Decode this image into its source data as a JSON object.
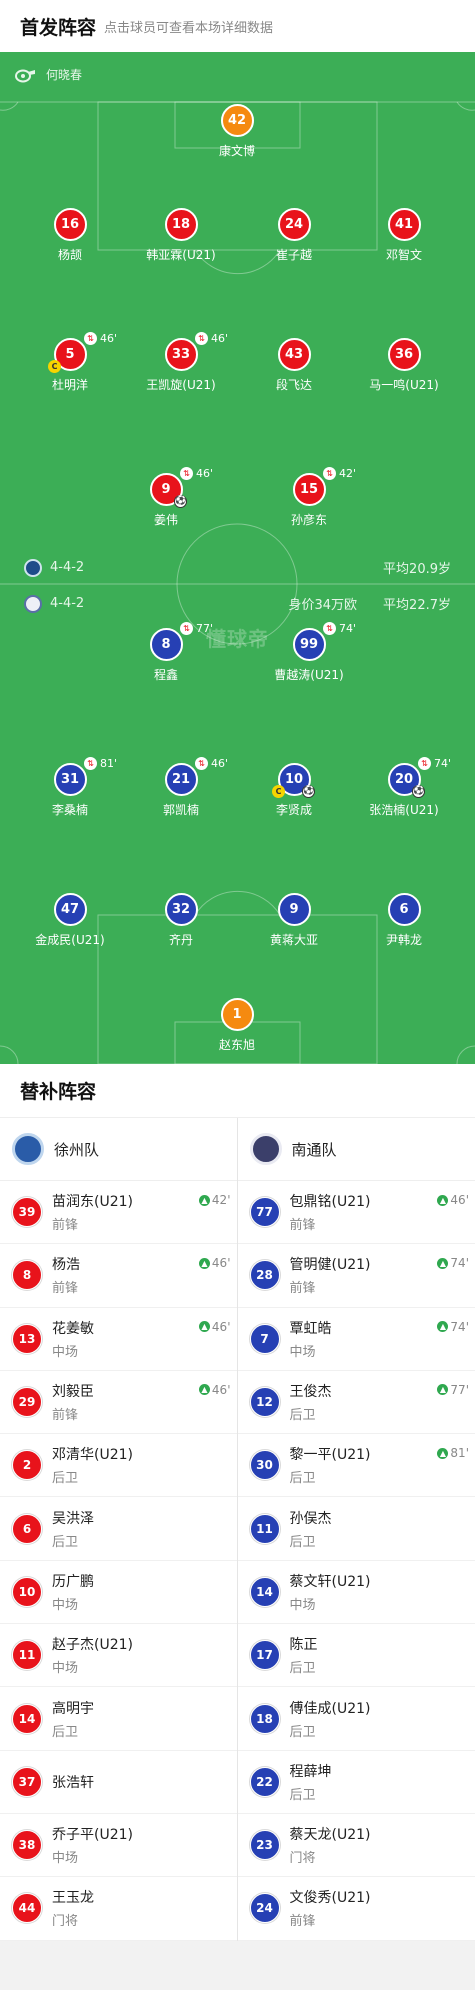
{
  "header": {
    "title": "首发阵容",
    "hint": "点击球员可查看本场详细数据"
  },
  "referee": {
    "name": "何晓春",
    "icon": "whistle-icon"
  },
  "watermark": "懂球帝",
  "home_team": {
    "name": "南通队",
    "formation": "4-4-2",
    "avg_age": "平均20.9岁",
    "color": "#e8131b"
  },
  "away_team": {
    "name": "徐州队",
    "formation": "4-4-2",
    "worth": "身价34万欧",
    "avg_age": "平均22.7岁",
    "color": "#2640b4"
  },
  "pitch_players": [
    {
      "num": "42",
      "name": "康文博",
      "color": "orange"
    },
    {
      "num": "16",
      "name": "杨颉",
      "color": "red"
    },
    {
      "num": "18",
      "name": "韩亚霖(U21)",
      "color": "red"
    },
    {
      "num": "24",
      "name": "崔子越",
      "color": "red"
    },
    {
      "num": "41",
      "name": "邓智文",
      "color": "red"
    },
    {
      "num": "5",
      "name": "杜明洋",
      "color": "red",
      "sub": "46'",
      "captain": true
    },
    {
      "num": "33",
      "name": "王凯旋(U21)",
      "color": "red",
      "sub": "46'"
    },
    {
      "num": "43",
      "name": "段飞达",
      "color": "red"
    },
    {
      "num": "36",
      "name": "马一鸣(U21)",
      "color": "red"
    },
    {
      "num": "9",
      "name": "姜伟",
      "color": "red",
      "sub": "46'",
      "goal": true
    },
    {
      "num": "15",
      "name": "孙彦东",
      "color": "red",
      "sub": "42'"
    },
    {
      "num": "8",
      "name": "程鑫",
      "color": "blue",
      "sub": "77'"
    },
    {
      "num": "99",
      "name": "曹越涛(U21)",
      "color": "blue",
      "sub": "74'"
    },
    {
      "num": "31",
      "name": "李桑楠",
      "color": "blue",
      "sub": "81'"
    },
    {
      "num": "21",
      "name": "郭凯楠",
      "color": "blue",
      "sub": "46'"
    },
    {
      "num": "10",
      "name": "李贤成",
      "color": "blue",
      "captain": true,
      "goal": true
    },
    {
      "num": "20",
      "name": "张浩楠(U21)",
      "color": "blue",
      "sub": "74'",
      "goal": true
    },
    {
      "num": "47",
      "name": "金成民(U21)",
      "color": "blue"
    },
    {
      "num": "32",
      "name": "齐丹",
      "color": "blue"
    },
    {
      "num": "9",
      "name": "黄蒋大亚",
      "color": "blue"
    },
    {
      "num": "6",
      "name": "尹韩龙",
      "color": "blue"
    },
    {
      "num": "1",
      "name": "赵东旭",
      "color": "orange"
    }
  ],
  "captain_mark": "C",
  "subs": {
    "title": "替补阵容",
    "left_team": "徐州队",
    "right_team": "南通队",
    "left": [
      {
        "num": "39",
        "name": "苗润东(U21)",
        "pos": "前锋",
        "on": "42'"
      },
      {
        "num": "8",
        "name": "杨浩",
        "pos": "前锋",
        "on": "46'"
      },
      {
        "num": "13",
        "name": "花姜敏",
        "pos": "中场",
        "on": "46'"
      },
      {
        "num": "29",
        "name": "刘毅臣",
        "pos": "前锋",
        "on": "46'"
      },
      {
        "num": "2",
        "name": "邓清华(U21)",
        "pos": "后卫"
      },
      {
        "num": "6",
        "name": "吴洪泽",
        "pos": "后卫"
      },
      {
        "num": "10",
        "name": "历广鹏",
        "pos": "中场"
      },
      {
        "num": "11",
        "name": "赵子杰(U21)",
        "pos": "中场"
      },
      {
        "num": "14",
        "name": "高明宇",
        "pos": "后卫"
      },
      {
        "num": "37",
        "name": "张浩轩",
        "pos": ""
      },
      {
        "num": "38",
        "name": "乔子平(U21)",
        "pos": "中场"
      },
      {
        "num": "44",
        "name": "王玉龙",
        "pos": "门将"
      }
    ],
    "right": [
      {
        "num": "77",
        "name": "包鼎铭(U21)",
        "pos": "前锋",
        "on": "46'"
      },
      {
        "num": "28",
        "name": "管明健(U21)",
        "pos": "前锋",
        "on": "74'"
      },
      {
        "num": "7",
        "name": "覃虹皓",
        "pos": "中场",
        "on": "74'"
      },
      {
        "num": "12",
        "name": "王俊杰",
        "pos": "后卫",
        "on": "77'"
      },
      {
        "num": "30",
        "name": "黎一平(U21)",
        "pos": "后卫",
        "on": "81'"
      },
      {
        "num": "11",
        "name": "孙俣杰",
        "pos": "后卫"
      },
      {
        "num": "14",
        "name": "蔡文轩(U21)",
        "pos": "中场"
      },
      {
        "num": "17",
        "name": "陈正",
        "pos": "后卫"
      },
      {
        "num": "18",
        "name": "傅佳成(U21)",
        "pos": "后卫"
      },
      {
        "num": "22",
        "name": "程薛坤",
        "pos": "后卫"
      },
      {
        "num": "23",
        "name": "蔡天龙(U21)",
        "pos": "门将"
      },
      {
        "num": "24",
        "name": "文俊秀(U21)",
        "pos": "前锋"
      }
    ]
  }
}
